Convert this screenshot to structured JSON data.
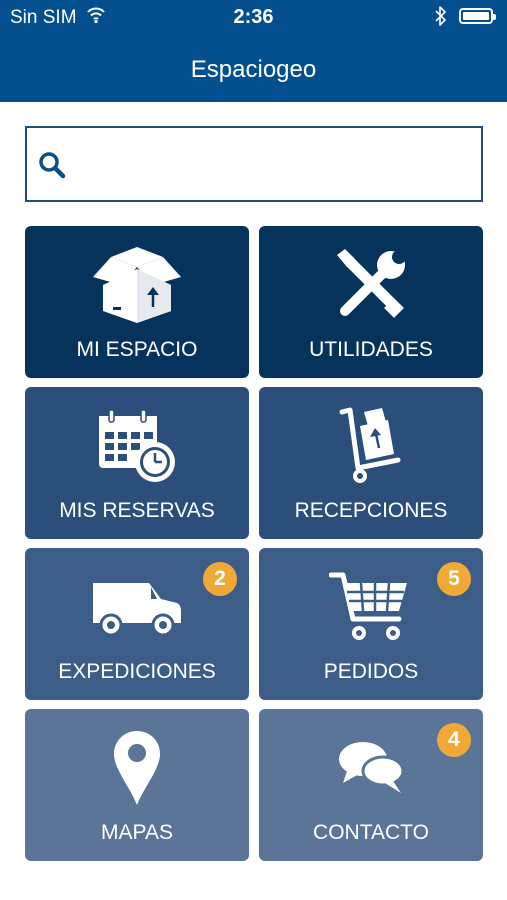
{
  "status_bar": {
    "carrier": "Sin SIM",
    "time": "2:36"
  },
  "app": {
    "title": "Espaciogeo"
  },
  "search": {
    "value": "",
    "placeholder": ""
  },
  "tiles": [
    {
      "label": "MI ESPACIO",
      "icon": "box-icon"
    },
    {
      "label": "UTILIDADES",
      "icon": "tools-icon"
    },
    {
      "label": "MIS RESERVAS",
      "icon": "calendar-clock-icon"
    },
    {
      "label": "RECEPCIONES",
      "icon": "hand-truck-icon"
    },
    {
      "label": "EXPEDICIONES",
      "icon": "van-icon",
      "badge": "2"
    },
    {
      "label": "PEDIDOS",
      "icon": "cart-icon",
      "badge": "5"
    },
    {
      "label": "MAPAS",
      "icon": "map-pin-icon"
    },
    {
      "label": "CONTACTO",
      "icon": "chat-icon",
      "badge": "4"
    }
  ],
  "colors": {
    "header": "#044f8d",
    "badge": "#f0a936"
  }
}
